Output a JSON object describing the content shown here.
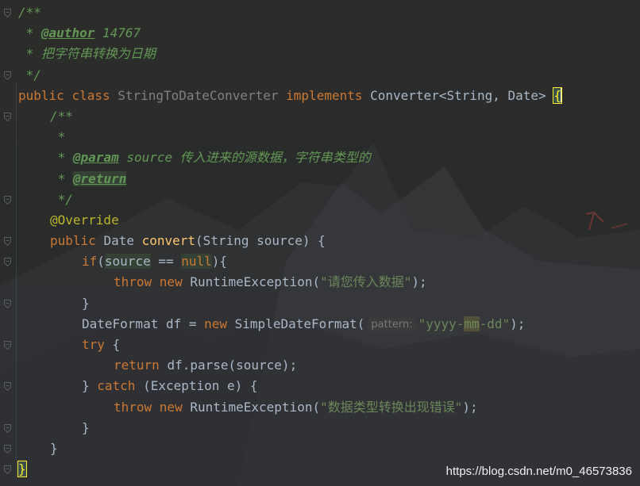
{
  "editor": {
    "lines": [
      {
        "segments": [
          {
            "t": "/**",
            "c": "cmt"
          }
        ]
      },
      {
        "segments": [
          {
            "t": " * ",
            "c": "cmt"
          },
          {
            "t": "@author",
            "c": "cmt-tag"
          },
          {
            "t": " 14767",
            "c": "cmt"
          }
        ]
      },
      {
        "segments": [
          {
            "t": " * 把字符串转换为日期",
            "c": "cmt"
          }
        ]
      },
      {
        "segments": [
          {
            "t": " */",
            "c": "cmt"
          }
        ]
      },
      {
        "segments": [
          {
            "t": "public ",
            "c": "kw"
          },
          {
            "t": "class ",
            "c": "kw"
          },
          {
            "t": "StringToDateConverter ",
            "c": "cls-plain"
          },
          {
            "t": "implements ",
            "c": "kw"
          },
          {
            "t": "Converter<String, Date> ",
            "c": "ident"
          },
          {
            "t": "{",
            "c": "brace-match"
          }
        ]
      },
      {
        "indent": 1,
        "segments": [
          {
            "t": "/**",
            "c": "cmt"
          }
        ]
      },
      {
        "indent": 1,
        "segments": [
          {
            "t": " *",
            "c": "cmt"
          }
        ]
      },
      {
        "indent": 1,
        "segments": [
          {
            "t": " * ",
            "c": "cmt"
          },
          {
            "t": "@param",
            "c": "cmt-tag"
          },
          {
            "t": " source",
            "c": "cmt"
          },
          {
            "t": " 传入进来的源数据，字符串类型的",
            "c": "cmt"
          }
        ]
      },
      {
        "indent": 1,
        "segments": [
          {
            "t": " * ",
            "c": "cmt"
          },
          {
            "t": "@return",
            "c": "cmt-tag cmt-hl"
          }
        ]
      },
      {
        "indent": 1,
        "segments": [
          {
            "t": " */",
            "c": "cmt"
          }
        ]
      },
      {
        "indent": 1,
        "segments": [
          {
            "t": "@Override",
            "c": "ann"
          }
        ]
      },
      {
        "indent": 1,
        "segments": [
          {
            "t": "public ",
            "c": "kw"
          },
          {
            "t": "Date ",
            "c": "ident"
          },
          {
            "t": "convert",
            "c": "fn"
          },
          {
            "t": "(String source) {",
            "c": "ident"
          }
        ]
      },
      {
        "indent": 2,
        "segments": [
          {
            "t": "if",
            "c": "kw"
          },
          {
            "t": "(",
            "c": "punc"
          },
          {
            "t": "source",
            "c": "ident var-hl"
          },
          {
            "t": " == ",
            "c": "punc"
          },
          {
            "t": "null",
            "c": "kw var-hl"
          },
          {
            "t": "){",
            "c": "punc"
          }
        ]
      },
      {
        "indent": 3,
        "segments": [
          {
            "t": "throw ",
            "c": "kw"
          },
          {
            "t": "new ",
            "c": "kw"
          },
          {
            "t": "RuntimeException(",
            "c": "ident"
          },
          {
            "t": "\"请您传入数据\"",
            "c": "str"
          },
          {
            "t": ");",
            "c": "punc"
          }
        ]
      },
      {
        "indent": 2,
        "segments": [
          {
            "t": "}",
            "c": "punc"
          }
        ]
      },
      {
        "indent": 2,
        "segments": [
          {
            "t": "DateFormat df = ",
            "c": "ident"
          },
          {
            "t": "new ",
            "c": "kw"
          },
          {
            "t": "SimpleDateFormat(",
            "c": "ident"
          },
          {
            "t": "pattern:",
            "c": "hint"
          },
          {
            "t": "\"yyyy-",
            "c": "str"
          },
          {
            "t": "mm",
            "c": "str str-hl"
          },
          {
            "t": "-dd\"",
            "c": "str"
          },
          {
            "t": ");",
            "c": "punc"
          }
        ]
      },
      {
        "indent": 2,
        "segments": [
          {
            "t": "try ",
            "c": "kw"
          },
          {
            "t": "{",
            "c": "punc"
          }
        ]
      },
      {
        "indent": 3,
        "segments": [
          {
            "t": "return ",
            "c": "kw"
          },
          {
            "t": "df.parse(source);",
            "c": "ident"
          }
        ]
      },
      {
        "indent": 2,
        "segments": [
          {
            "t": "} ",
            "c": "punc"
          },
          {
            "t": "catch ",
            "c": "kw"
          },
          {
            "t": "(Exception e) {",
            "c": "ident"
          }
        ]
      },
      {
        "indent": 3,
        "segments": [
          {
            "t": "throw ",
            "c": "kw"
          },
          {
            "t": "new ",
            "c": "kw"
          },
          {
            "t": "RuntimeException(",
            "c": "ident"
          },
          {
            "t": "\"数据类型转换出现错误\"",
            "c": "str"
          },
          {
            "t": ");",
            "c": "punc"
          }
        ]
      },
      {
        "indent": 2,
        "segments": [
          {
            "t": "}",
            "c": "punc"
          }
        ]
      },
      {
        "indent": 1,
        "segments": [
          {
            "t": "}",
            "c": "punc"
          }
        ]
      },
      {
        "segments": [
          {
            "t": "}",
            "c": "brace-match"
          }
        ]
      }
    ],
    "fold_markers_on_lines": [
      0,
      3,
      5,
      9,
      11,
      12,
      14,
      16,
      18,
      20,
      21,
      22
    ],
    "caret_line": 4
  },
  "watermark": "https://blog.csdn.net/m0_46573836",
  "colors": {
    "background": "#2b2b2b",
    "keyword": "#cc7832",
    "comment": "#629755",
    "string": "#6a8759",
    "annotation": "#bbb529",
    "function": "#ffc66d",
    "text": "#a9b7c6"
  }
}
